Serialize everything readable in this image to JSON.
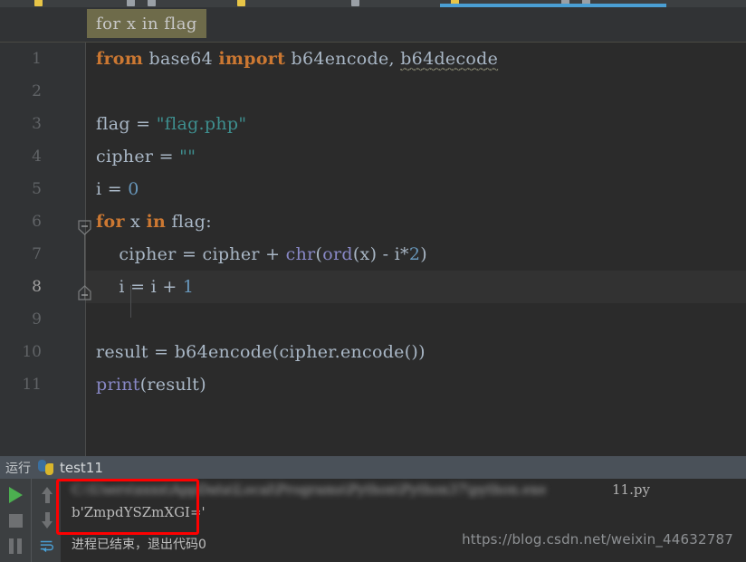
{
  "window": {
    "theme_bg": "#2b2b2b",
    "accent": "#4a9fd4"
  },
  "tabstrip": {
    "active_tab_indicator_color": "#4a9fd4",
    "tabs": [
      {
        "icon": "python-file-icon",
        "label": ""
      },
      {
        "icon": "text-file-icon",
        "label": ""
      },
      {
        "icon": "python-file-icon",
        "label": ""
      },
      {
        "icon": "text-file-icon",
        "label": ""
      },
      {
        "icon": "python-file-icon",
        "label": ""
      }
    ]
  },
  "context_bar": {
    "breadcrumb_text": "for x in flag",
    "chip_bg": "#6e6b4a"
  },
  "editor": {
    "lines": [
      {
        "n": "1",
        "tokens": [
          {
            "t": "from",
            "c": "kw"
          },
          {
            "t": " base64 ",
            "c": "ident"
          },
          {
            "t": "import",
            "c": "kw"
          },
          {
            "t": " b64encode, ",
            "c": "ident"
          },
          {
            "t": "b64decode",
            "c": "unused"
          }
        ]
      },
      {
        "n": "2",
        "tokens": []
      },
      {
        "n": "3",
        "tokens": [
          {
            "t": "flag = ",
            "c": "ident"
          },
          {
            "t": "\"flag.php\"",
            "c": "str"
          }
        ]
      },
      {
        "n": "4",
        "tokens": [
          {
            "t": "cipher = ",
            "c": "ident"
          },
          {
            "t": "\"\"",
            "c": "str"
          }
        ]
      },
      {
        "n": "5",
        "tokens": [
          {
            "t": "i = ",
            "c": "ident"
          },
          {
            "t": "0",
            "c": "num"
          }
        ]
      },
      {
        "n": "6",
        "tokens": [
          {
            "t": "for",
            "c": "kw"
          },
          {
            "t": " x ",
            "c": "ident"
          },
          {
            "t": "in",
            "c": "kw"
          },
          {
            "t": " flag:",
            "c": "ident"
          }
        ]
      },
      {
        "n": "7",
        "tokens": [
          {
            "t": "    cipher = cipher + ",
            "c": "ident"
          },
          {
            "t": "chr",
            "c": "bi"
          },
          {
            "t": "(",
            "c": "ident"
          },
          {
            "t": "ord",
            "c": "bi"
          },
          {
            "t": "(x) - i*",
            "c": "ident"
          },
          {
            "t": "2",
            "c": "num"
          },
          {
            "t": ")",
            "c": "ident"
          }
        ]
      },
      {
        "n": "8",
        "tokens": [
          {
            "t": "    i = i + ",
            "c": "ident"
          },
          {
            "t": "1",
            "c": "num"
          }
        ],
        "current": true
      },
      {
        "n": "9",
        "tokens": []
      },
      {
        "n": "10",
        "tokens": [
          {
            "t": "result = b64encode(cipher.encode())",
            "c": "ident"
          }
        ]
      },
      {
        "n": "11",
        "tokens": [
          {
            "t": "print",
            "c": "bi"
          },
          {
            "t": "(result)",
            "c": "ident"
          }
        ]
      }
    ],
    "fold_markers": [
      {
        "line": "6",
        "type": "fold-collapse-start-icon"
      },
      {
        "line": "8",
        "type": "fold-collapse-end-icon"
      }
    ]
  },
  "run_panel": {
    "title": "运行",
    "config_name": "test11",
    "config_icon": "python-icon",
    "toolbar": [
      {
        "name": "rerun-button",
        "icon": "play-icon"
      },
      {
        "name": "stop-button",
        "icon": "stop-square-icon"
      },
      {
        "name": "pause-button",
        "icon": "pause-icon"
      },
      {
        "name": "scroll-up-button",
        "icon": "arrow-up-icon"
      },
      {
        "name": "scroll-down-button",
        "icon": "arrow-down-icon"
      },
      {
        "name": "soft-wrap-button",
        "icon": "soft-wrap-icon"
      }
    ],
    "console": {
      "command_line_redacted": "C:\\Users\\xxxx\\AppData\\Local\\Programs\\Python\\Python37\\python.exe",
      "command_line_tail": "11.py",
      "output": "b'ZmpdYSZmXGI='",
      "exit_message": "进程已结束，退出代码0"
    }
  },
  "annotation": {
    "highlight_color": "#fe0000",
    "highlight_target": "b'ZmpdYSZmXGI='"
  },
  "watermark": {
    "text": "https://blog.csdn.net/weixin_44632787"
  }
}
